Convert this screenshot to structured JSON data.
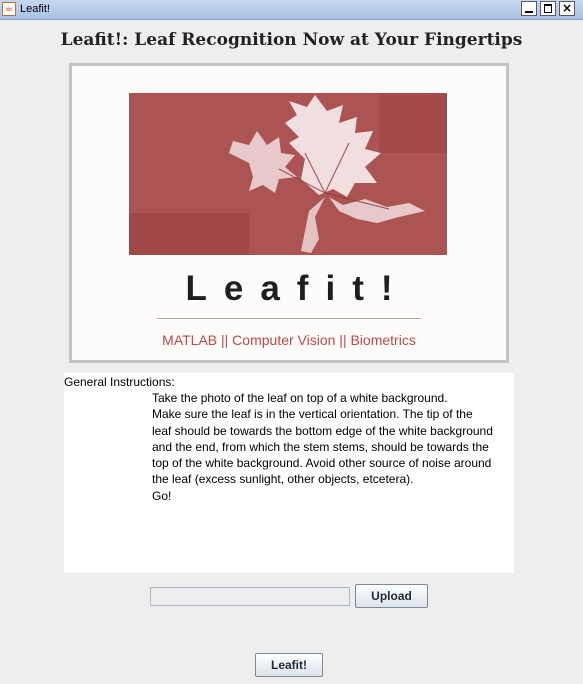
{
  "window": {
    "title": "Leafit!",
    "icon": "java-cup-icon",
    "controls": {
      "minimize": "minimize-icon",
      "maximize": "maximize-icon",
      "close": "×"
    }
  },
  "heading": "Leafit!: Leaf Recognition Now at Your Fingertips",
  "banner": {
    "brand": "Leafit!",
    "tagline": "MATLAB || Computer Vision || Biometrics",
    "photo_tint": "#b25a5a",
    "tagline_color": "#bb4a4a"
  },
  "instructions": {
    "title": "General Instructions:",
    "lines": [
      "Take the photo of the leaf on top of a white background.",
      "Make sure the leaf is in the vertical orientation. The tip of the",
      "leaf should be towards the bottom edge of the white background",
      "and the end, from which the stem stems, should be towards the",
      "top of the white background. Avoid other source of noise around",
      "the leaf (excess sunlight, other objects, etcetera).",
      "Go!"
    ]
  },
  "upload": {
    "path_value": "",
    "button_label": "Upload"
  },
  "action": {
    "button_label": "Leafit!"
  }
}
